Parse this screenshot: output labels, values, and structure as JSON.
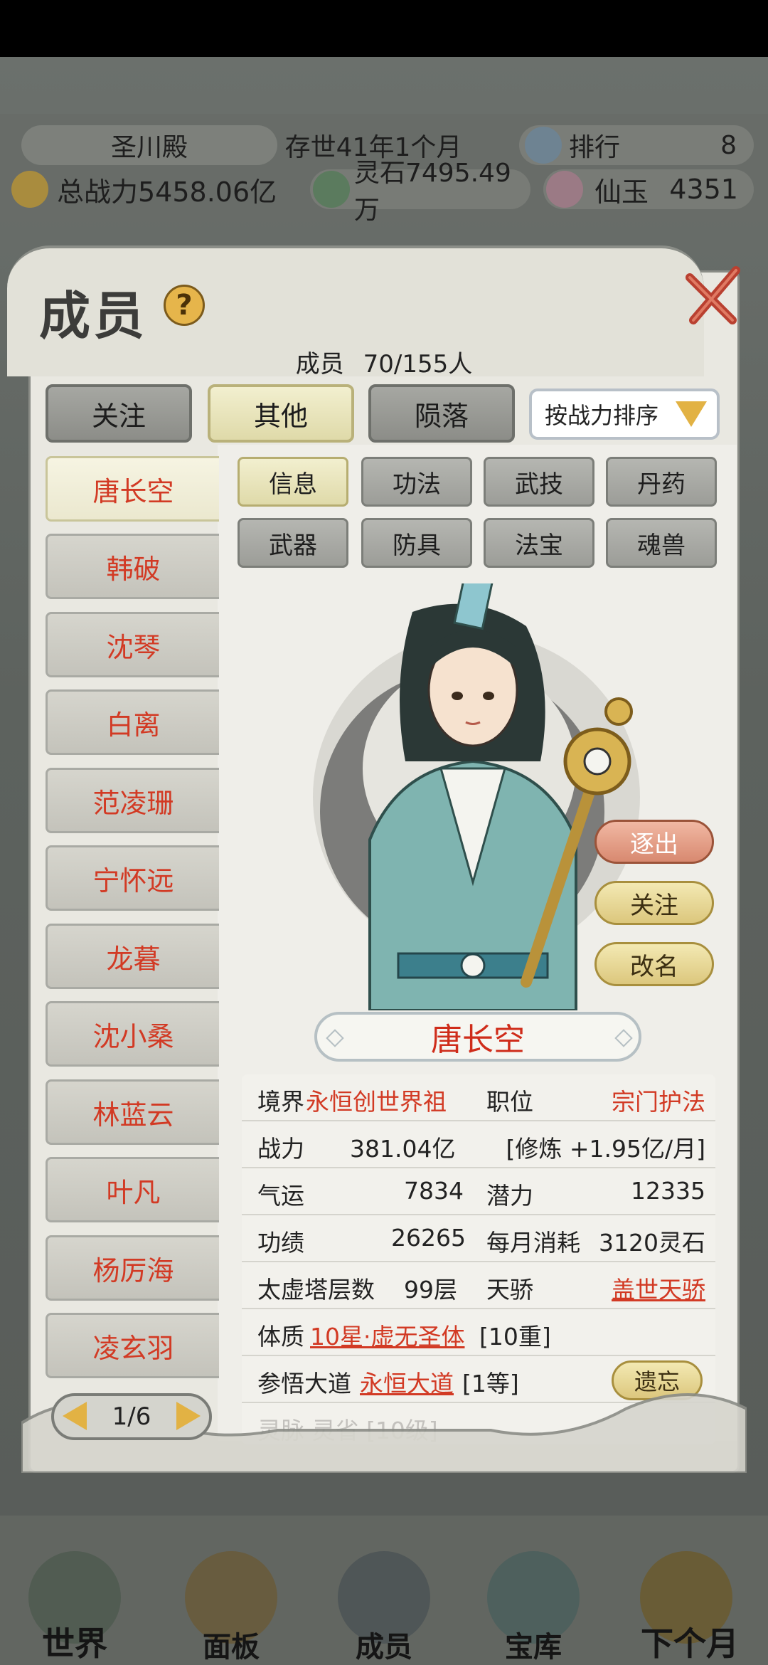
{
  "top_bar": {
    "sect_name": "圣川殿",
    "existence_time": "存世41年1个月",
    "rank_label": "排行",
    "rank_value": "8",
    "total_power": "总战力5458.06亿",
    "spirit_stones": "灵石7495.49万",
    "jade_label": "仙玉",
    "jade_value": "4351"
  },
  "panel": {
    "title": "成员",
    "help_glyph": "?",
    "count_label": "成员",
    "count_value": "70/155人"
  },
  "tabs": [
    {
      "label": "关注",
      "active": false
    },
    {
      "label": "其他",
      "active": true
    },
    {
      "label": "陨落",
      "active": false
    }
  ],
  "sort": {
    "label": "按战力排序"
  },
  "members": [
    {
      "name": "唐长空",
      "active": true
    },
    {
      "name": "韩破"
    },
    {
      "name": "沈琴"
    },
    {
      "name": "白离"
    },
    {
      "name": "范凌珊"
    },
    {
      "name": "宁怀远"
    },
    {
      "name": "龙暮"
    },
    {
      "name": "沈小桑"
    },
    {
      "name": "林蓝云"
    },
    {
      "name": "叶凡"
    },
    {
      "name": "杨厉海"
    },
    {
      "name": "凌玄羽"
    }
  ],
  "pager": {
    "label": "1/6"
  },
  "subtabs": [
    {
      "label": "信息",
      "active": true
    },
    {
      "label": "功法"
    },
    {
      "label": "武技"
    },
    {
      "label": "丹药"
    },
    {
      "label": "武器"
    },
    {
      "label": "防具"
    },
    {
      "label": "法宝"
    },
    {
      "label": "魂兽"
    }
  ],
  "actions": {
    "expel": "逐出",
    "follow": "关注",
    "rename": "改名"
  },
  "character": {
    "name": "唐长空",
    "realm_label": "境界",
    "realm_value": "永恒创世界祖",
    "position_label": "职位",
    "position_value": "宗门护法",
    "power_label": "战力",
    "power_value": "381.04亿",
    "cultivation_rate": "[修炼 +1.95亿/月]",
    "luck_label": "气运",
    "luck_value": "7834",
    "potential_label": "潜力",
    "potential_value": "12335",
    "merit_label": "功绩",
    "merit_value": "26265",
    "monthly_cost_label": "每月消耗",
    "monthly_cost_value": "3120灵石",
    "tower_label": "太虚塔层数",
    "tower_value": "99层",
    "talent_label": "天骄",
    "talent_value": "盖世天骄",
    "physique_label": "体质",
    "physique_value": "10星·虚无圣体",
    "physique_level": "[10重]",
    "dao_label": "参悟大道",
    "dao_value": "永恒大道",
    "dao_level": "[1等]",
    "forget_button": "遗忘",
    "faded_row": "灵脉 灵省 [10级]"
  },
  "bottom_nav": [
    {
      "label": "世界",
      "icon": "world-icon"
    },
    {
      "label": "面板",
      "icon": "panel-icon"
    },
    {
      "label": "成员",
      "icon": "members-icon"
    },
    {
      "label": "宝库",
      "icon": "treasury-icon"
    },
    {
      "label": "下个月",
      "icon": "next-month-icon"
    }
  ],
  "colors": {
    "accent_red": "#d23a24",
    "gold": "#e2b244",
    "panel_bg": "#e9e8e1"
  }
}
